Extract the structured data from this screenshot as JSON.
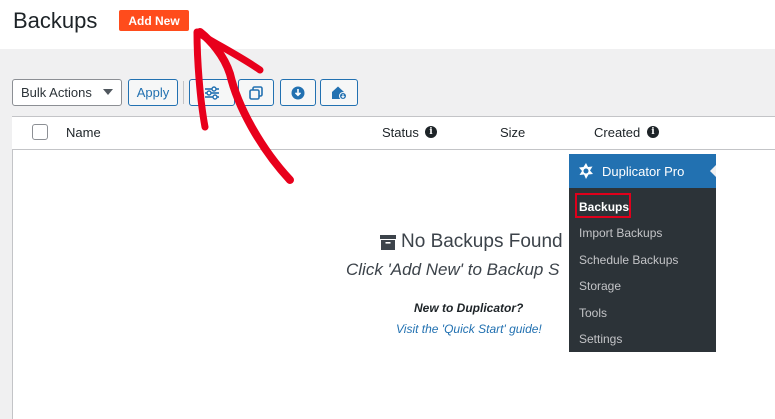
{
  "header": {
    "title": "Backups",
    "add_new_label": "Add New"
  },
  "toolbar": {
    "bulk_actions": "Bulk Actions",
    "apply_label": "Apply",
    "icon_buttons": [
      "settings-sliders-icon",
      "copy-icon",
      "download-icon",
      "home-download-icon"
    ]
  },
  "table": {
    "columns": {
      "name": "Name",
      "status": "Status",
      "size": "Size",
      "created": "Created"
    }
  },
  "empty_state": {
    "title": "No Backups Found",
    "subtitle": "Click 'Add New' to Backup S",
    "new_to": "New to Duplicator?",
    "quick_start": "Visit the 'Quick Start' guide!"
  },
  "menu": {
    "title": "Duplicator Pro",
    "items": [
      "Backups",
      "Import Backups",
      "Schedule Backups",
      "Storage",
      "Tools",
      "Settings"
    ]
  },
  "colors": {
    "add_new": "#ff4c1c",
    "accent": "#2271b1",
    "menu_bg": "#2c3338",
    "highlight": "#e0001b",
    "annotation_arrow": "#e8001c"
  }
}
